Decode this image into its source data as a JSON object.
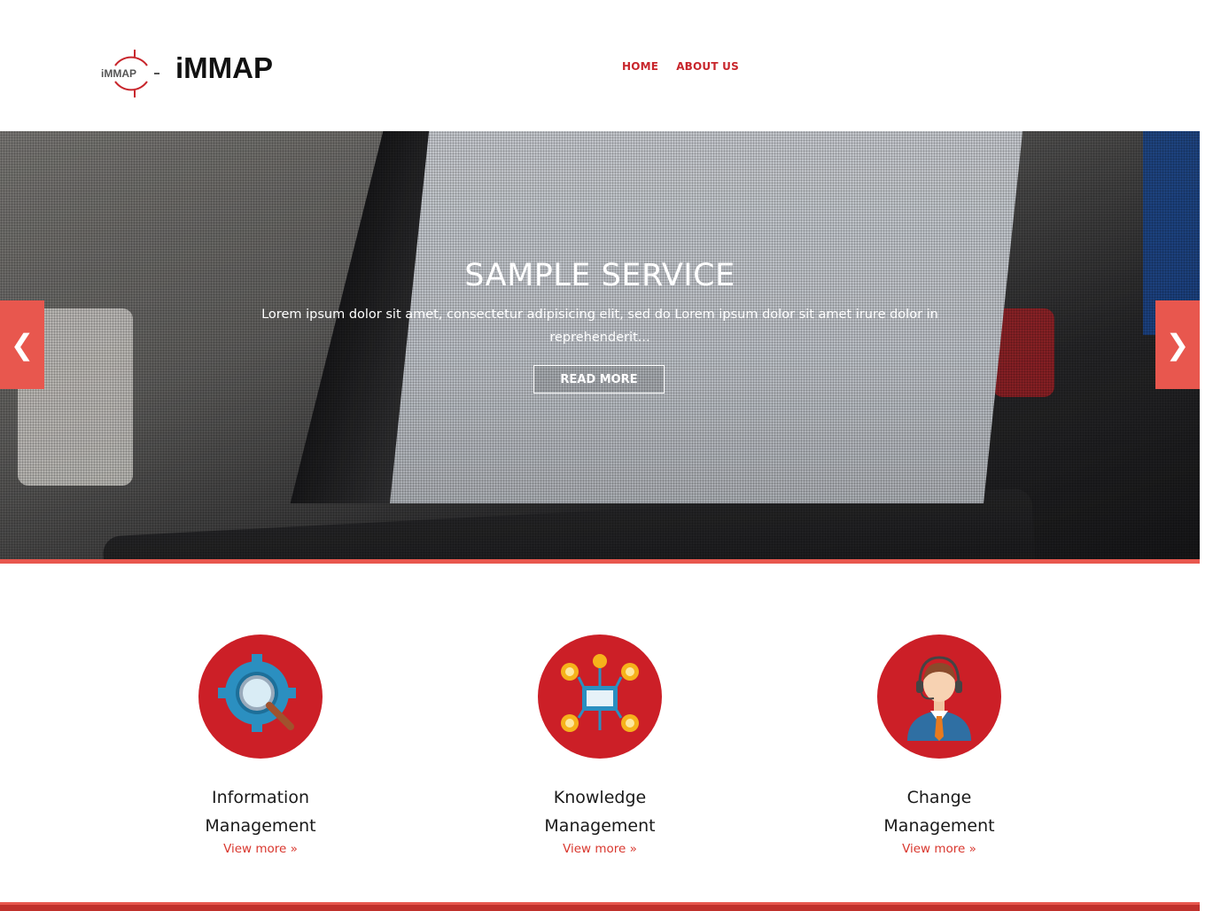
{
  "header": {
    "brand": "iMMAP",
    "logo_text": "iMMAP",
    "nav": [
      {
        "label": "HOME",
        "active": true
      },
      {
        "label": "ABOUT US",
        "active": false
      }
    ]
  },
  "hero": {
    "title": "SAMPLE SERVICE",
    "text": "Lorem ipsum dolor sit amet, consectetur adipisicing elit, sed do Lorem ipsum dolor sit amet irure dolor in reprehenderit...",
    "button": "READ MORE",
    "prev_icon": "chevron-left-icon",
    "next_icon": "chevron-right-icon"
  },
  "services": [
    {
      "title_line1": "Information",
      "title_line2": "Management",
      "more": "View more »",
      "icon": "gear-search-icon"
    },
    {
      "title_line1": "Knowledge",
      "title_line2": "Management",
      "more": "View more »",
      "icon": "network-icon"
    },
    {
      "title_line1": "Change",
      "title_line2": "Management",
      "more": "View more »",
      "icon": "support-agent-icon"
    }
  ],
  "colors": {
    "accent": "#e8574e",
    "brand_red": "#cc1f27",
    "nav_text": "#c8262c"
  }
}
